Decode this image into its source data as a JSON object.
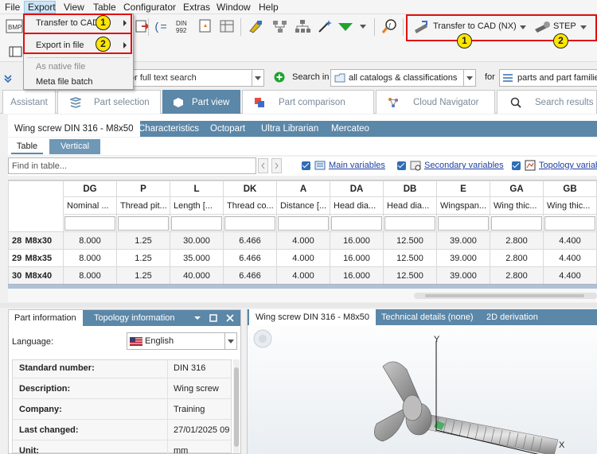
{
  "menubar": {
    "items": [
      "File",
      "Export",
      "View",
      "Table",
      "Configurator",
      "Extras",
      "Window",
      "Help"
    ]
  },
  "export_menu": {
    "items": [
      {
        "label": "Transfer to CAD",
        "submenu": true,
        "enabled": true
      },
      {
        "label": "Export in file",
        "submenu": true,
        "enabled": true
      },
      {
        "label": "As native file",
        "submenu": false,
        "enabled": false
      },
      {
        "label": "Meta file batch",
        "submenu": false,
        "enabled": true
      }
    ]
  },
  "toolbar": {
    "transfer_cad_label": "Transfer to CAD (NX)",
    "format_label": "STEP",
    "icons": [
      "bmp-icon",
      "export-icon",
      "variables-icon",
      "din-icon",
      "favorite-icon",
      "table-icon",
      "configure-icon",
      "network-icon",
      "hierarchy-icon",
      "magic-wand-icon",
      "green-arrow-icon",
      "search-zoom-icon"
    ]
  },
  "callouts": {
    "one": "1",
    "two": "2"
  },
  "search": {
    "placeholder": "or full text search",
    "search_in_label": "Search in",
    "scope_value": "all catalogs & classifications",
    "for_label": "for",
    "for_value": "parts and part families"
  },
  "main_tabs": [
    "Assistant",
    "Part selection",
    "Part view",
    "Part comparison",
    "Cloud Navigator",
    "Search results"
  ],
  "sub_tabs": [
    "Wing screw DIN 316 - M8x50",
    "Characteristics",
    "Octopart",
    "Ultra Librarian",
    "Mercateo"
  ],
  "view_tabs": [
    "Table",
    "Vertical"
  ],
  "find": {
    "placeholder": "Find in table...",
    "main_variables": "Main variables",
    "secondary_variables": "Secondary variables",
    "topology_variables": "Topology variables"
  },
  "table": {
    "columns": [
      {
        "code": "DG",
        "desc": "Nominal ..."
      },
      {
        "code": "P",
        "desc": "Thread pit..."
      },
      {
        "code": "L",
        "desc": "Length [..."
      },
      {
        "code": "DK",
        "desc": "Thread co..."
      },
      {
        "code": "A",
        "desc": "Distance [..."
      },
      {
        "code": "DA",
        "desc": "Head dia..."
      },
      {
        "code": "DB",
        "desc": "Head dia..."
      },
      {
        "code": "E",
        "desc": "Wingspan..."
      },
      {
        "code": "GA",
        "desc": "Wing thic..."
      },
      {
        "code": "GB",
        "desc": "Wing thic..."
      }
    ],
    "rows": [
      {
        "num": "28",
        "id": "M8x30",
        "values": [
          "8.000",
          "1.25",
          "30.000",
          "6.466",
          "4.000",
          "16.000",
          "12.500",
          "39.000",
          "2.800",
          "4.400"
        ]
      },
      {
        "num": "29",
        "id": "M8x35",
        "values": [
          "8.000",
          "1.25",
          "35.000",
          "6.466",
          "4.000",
          "16.000",
          "12.500",
          "39.000",
          "2.800",
          "4.400"
        ]
      },
      {
        "num": "30",
        "id": "M8x40",
        "values": [
          "8.000",
          "1.25",
          "40.000",
          "6.466",
          "4.000",
          "16.000",
          "12.500",
          "39.000",
          "2.800",
          "4.400"
        ]
      }
    ]
  },
  "left_panel": {
    "tabs": [
      "Part information",
      "Topology information"
    ],
    "language_label": "Language:",
    "language_value": "English",
    "properties": [
      {
        "label": "Standard number:",
        "value": "DIN 316"
      },
      {
        "label": "Description:",
        "value": "Wing screw"
      },
      {
        "label": "Company:",
        "value": "Training"
      },
      {
        "label": "Last changed:",
        "value": "27/01/2025 09"
      },
      {
        "label": "Unit:",
        "value": "mm"
      }
    ]
  },
  "right_panel": {
    "tabs": [
      "Wing screw DIN 316 - M8x50",
      "Technical details (none)",
      "2D derivation"
    ],
    "axis_y": "Y",
    "axis_x": "X"
  },
  "colors": {
    "accent": "#5b87a8",
    "highlight": "#e01010",
    "callout": "#ffe600"
  }
}
